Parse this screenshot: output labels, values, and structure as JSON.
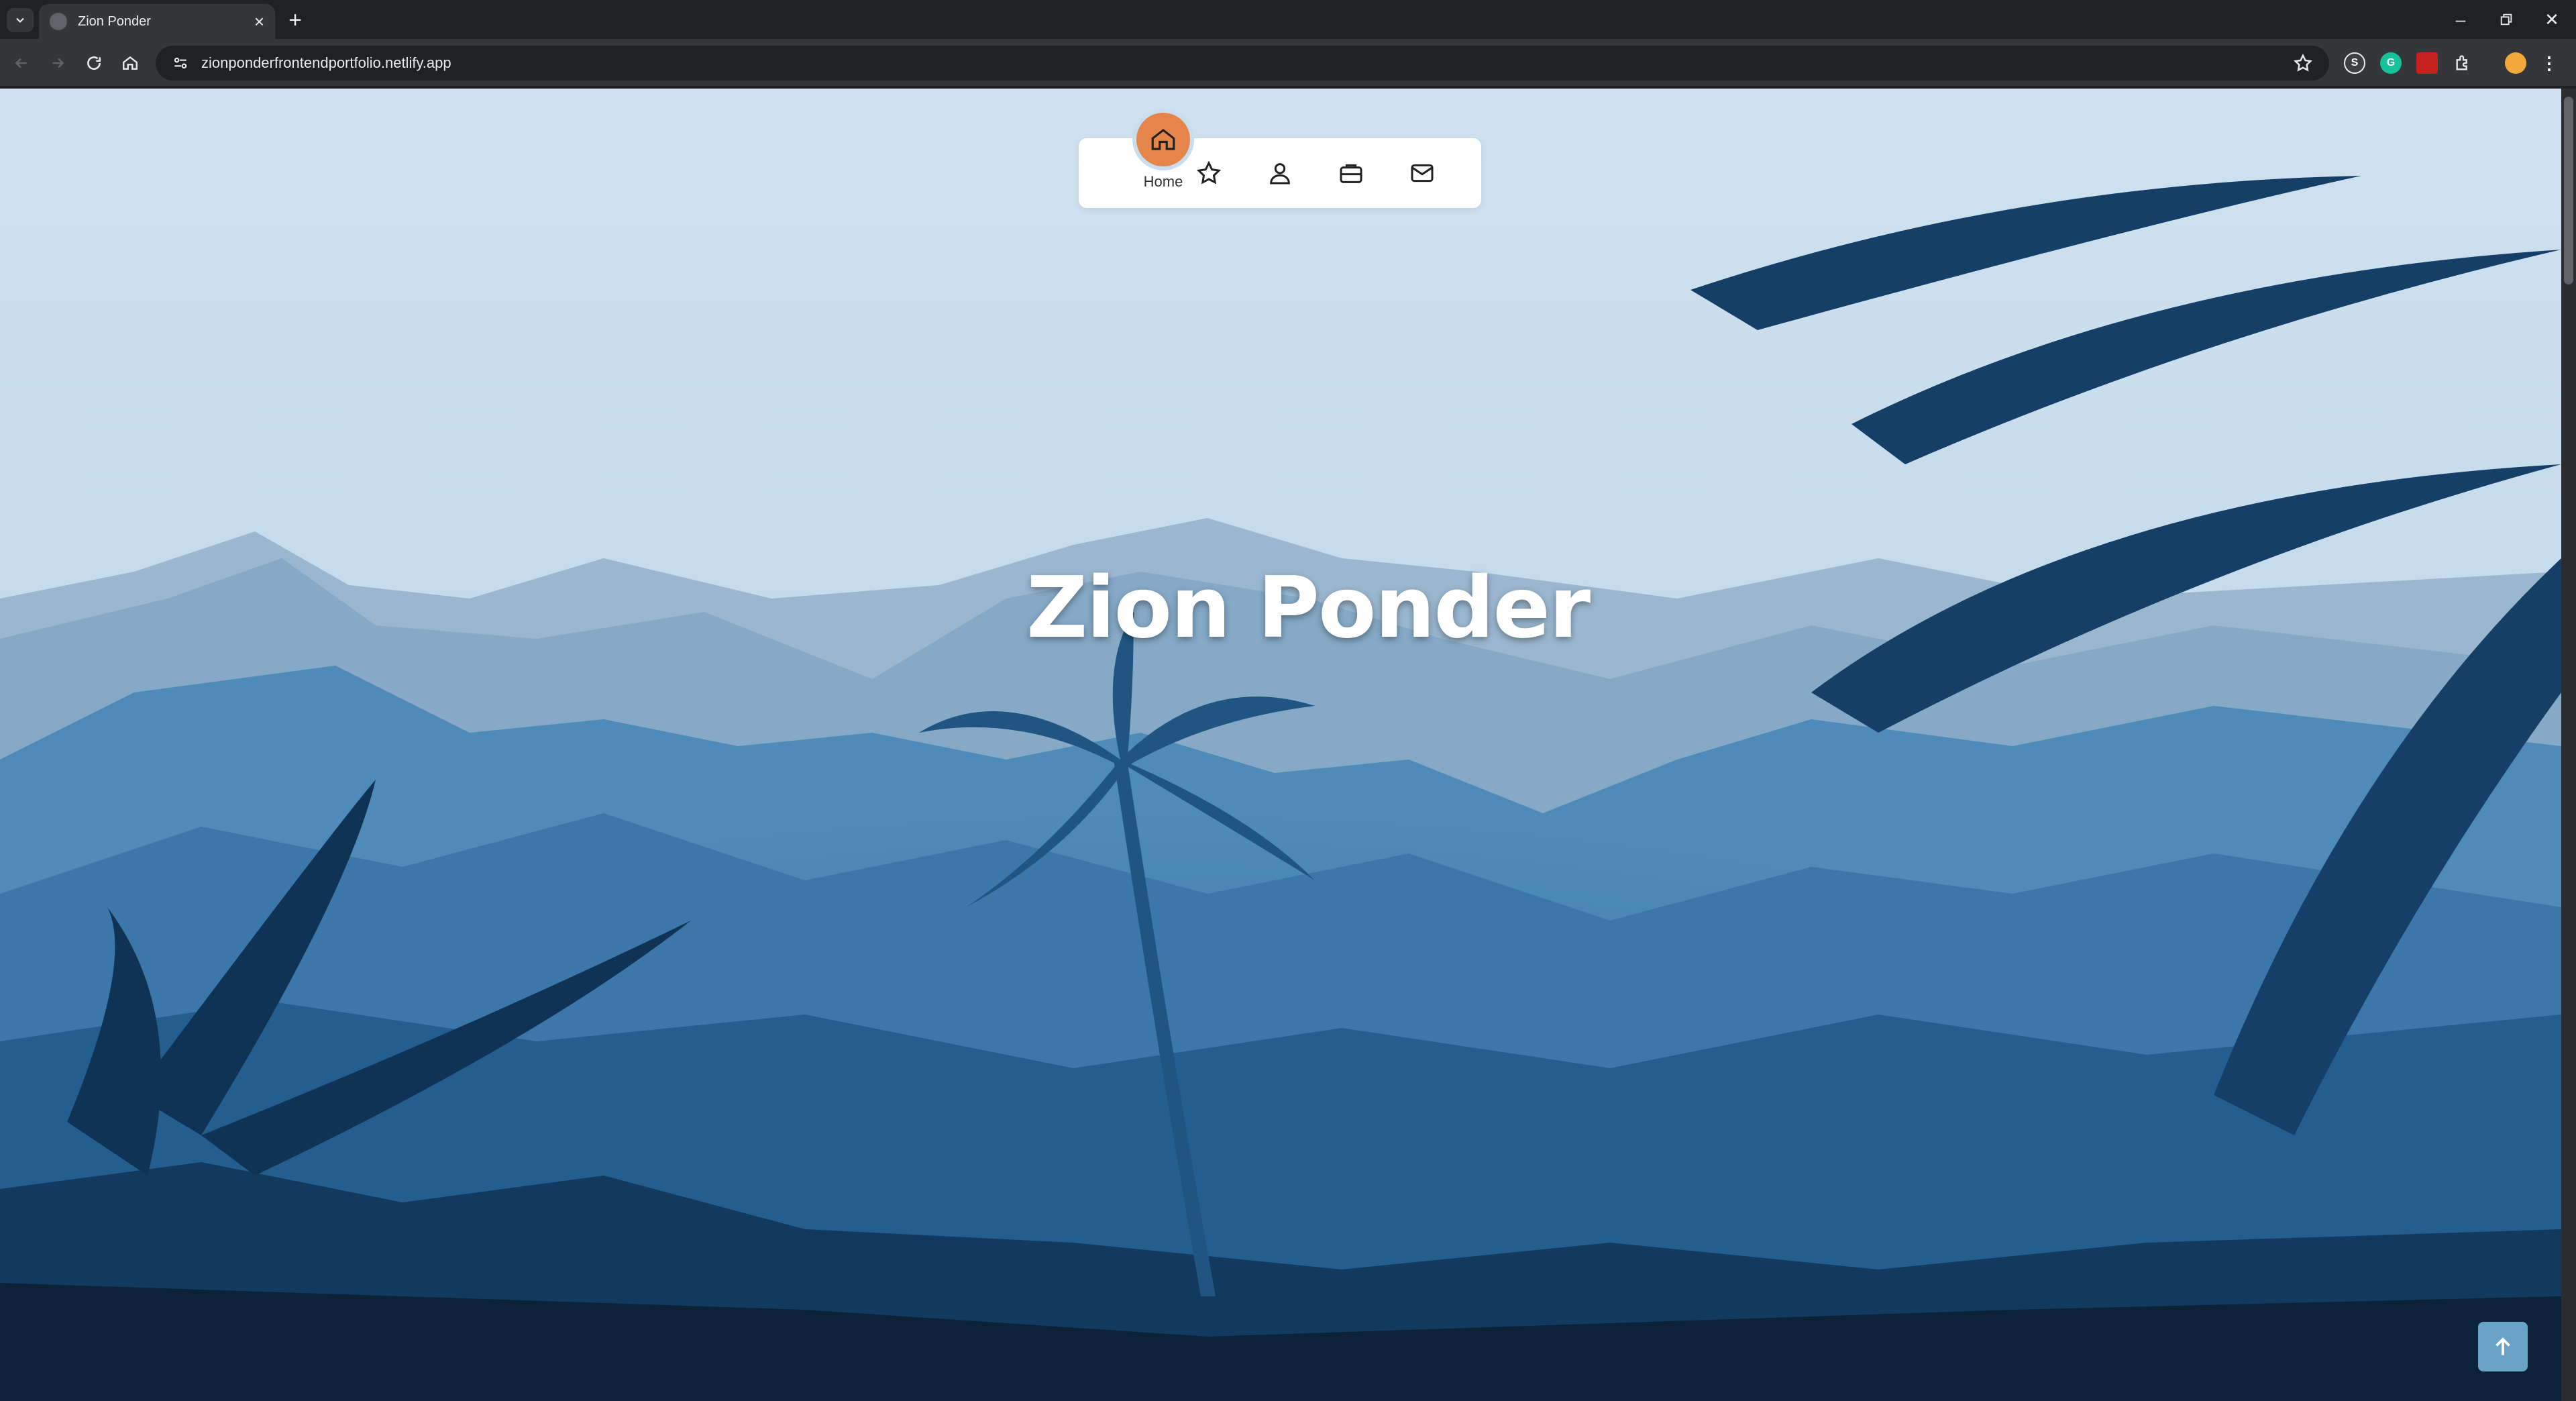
{
  "browser": {
    "tab_title": "Zion Ponder",
    "url": "zionponderfrontendportfolio.netlify.app"
  },
  "nav": {
    "items": [
      {
        "id": "home",
        "label": "Home",
        "icon": "home-icon",
        "active": true
      },
      {
        "id": "skills",
        "icon": "star-icon"
      },
      {
        "id": "about",
        "icon": "user-icon"
      },
      {
        "id": "portfolio",
        "icon": "briefcase-icon"
      },
      {
        "id": "contact",
        "icon": "mail-icon"
      }
    ]
  },
  "hero": {
    "title": "Zion Ponder"
  },
  "colors": {
    "accent": "#e6854a",
    "sky": "#c8ddee",
    "deep": "#0b2238",
    "scroll_top_button": "#6aa3c8"
  }
}
